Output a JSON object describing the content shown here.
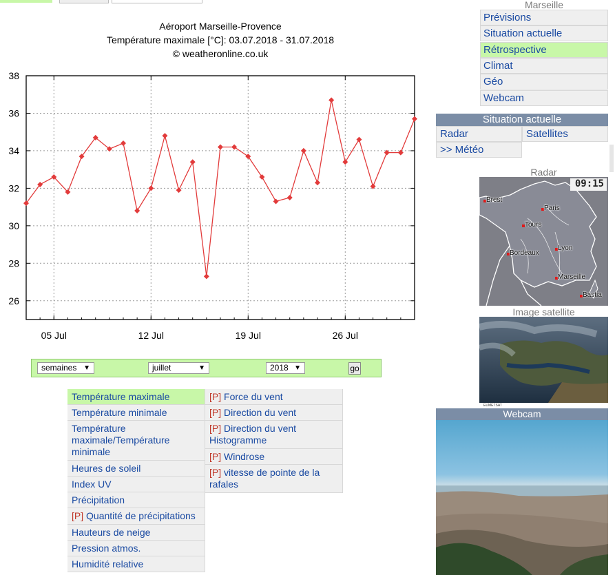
{
  "chart_header": {
    "title": "Aéroport Marseille-Provence",
    "subtitle": "Température maximale [°C]: 03.07.2018 - 31.07.2018",
    "credit": "© weatheronline.co.uk"
  },
  "chart_data": {
    "type": "line",
    "title": "Aéroport Marseille-Provence",
    "subtitle": "Température maximale [°C]: 03.07.2018 - 31.07.2018",
    "x": [
      "2018-07-03",
      "2018-07-04",
      "2018-07-05",
      "2018-07-06",
      "2018-07-07",
      "2018-07-08",
      "2018-07-09",
      "2018-07-10",
      "2018-07-11",
      "2018-07-12",
      "2018-07-13",
      "2018-07-14",
      "2018-07-15",
      "2018-07-16",
      "2018-07-17",
      "2018-07-18",
      "2018-07-19",
      "2018-07-20",
      "2018-07-21",
      "2018-07-22",
      "2018-07-23",
      "2018-07-24",
      "2018-07-25",
      "2018-07-26",
      "2018-07-27",
      "2018-07-28",
      "2018-07-29",
      "2018-07-30",
      "2018-07-31"
    ],
    "series": [
      {
        "values": [
          31.2,
          32.2,
          32.6,
          31.8,
          33.7,
          34.7,
          34.1,
          34.4,
          30.8,
          32.0,
          34.8,
          31.9,
          33.4,
          27.3,
          34.2,
          34.2,
          33.7,
          32.6,
          31.3,
          31.5,
          34.0,
          32.3,
          36.7,
          33.4,
          34.6,
          32.1,
          33.9,
          33.9,
          35.7
        ],
        "color": "#e23b3b"
      }
    ],
    "x_tick_labels": [
      "05 Jul",
      "12 Jul",
      "19 Jul",
      "26 Jul"
    ],
    "y_ticks": [
      26,
      28,
      30,
      32,
      34,
      36,
      38
    ],
    "ylim": [
      25,
      38
    ],
    "xlim": [
      "2018-07-03",
      "2018-07-31"
    ],
    "grid": true,
    "xlabel": "",
    "ylabel": ""
  },
  "selectors": {
    "period": "semaines",
    "month": "juillet",
    "year": "2018",
    "go": "go"
  },
  "menu_left": [
    {
      "label": "Température maximale",
      "prefix": "",
      "active": true
    },
    {
      "label": "Température minimale",
      "prefix": ""
    },
    {
      "label": "Température maximale/Température minimale",
      "prefix": ""
    },
    {
      "label": "Heures de soleil",
      "prefix": ""
    },
    {
      "label": "Index UV",
      "prefix": ""
    },
    {
      "label": "Précipitation",
      "prefix": ""
    },
    {
      "label": "Quantité de précipitations",
      "prefix": "[P]"
    },
    {
      "label": "Hauteurs de neige",
      "prefix": ""
    },
    {
      "label": "Pression atmos.",
      "prefix": ""
    },
    {
      "label": "Humidité relative",
      "prefix": ""
    }
  ],
  "menu_right": [
    {
      "label": "Force du vent",
      "prefix": "[P]"
    },
    {
      "label": "Direction du vent",
      "prefix": "[P]"
    },
    {
      "label": "Direction du vent Histogramme",
      "prefix": "[P]"
    },
    {
      "label": "Windrose",
      "prefix": "[P]"
    },
    {
      "label": "vitesse de pointe de la rafales",
      "prefix": "[P]"
    }
  ],
  "nav": {
    "heading": "Marseille",
    "items": [
      "Prévisions",
      "Situation actuelle",
      "Rétrospective",
      "Climat",
      "Géo",
      "Webcam"
    ],
    "active_index": 2
  },
  "situation": {
    "heading": "Situation actuelle",
    "radar": "Radar",
    "satellites": "Satellites",
    "meteo": ">> Météo"
  },
  "radar": {
    "heading": "Radar",
    "time": "09:15",
    "cities": [
      "Brest",
      "Paris",
      "Tours",
      "Bordeaux",
      "Lyon",
      "Marseille",
      "Bastia"
    ]
  },
  "satellite": {
    "heading": "Image satellite",
    "credit": "EUMETSAT"
  },
  "webcam": {
    "heading": "Webcam"
  },
  "colors": {
    "accent_green": "#c8f7a8",
    "link_blue": "#1a4aa2",
    "header_slate": "#7b8da6",
    "series_red": "#e23b3b"
  }
}
